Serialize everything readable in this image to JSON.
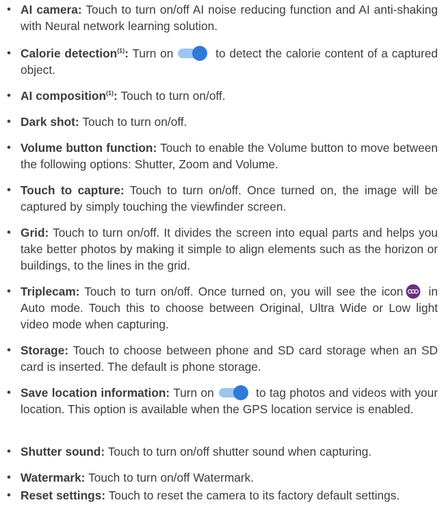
{
  "bullet_char": "•",
  "items": [
    {
      "term": "AI camera:",
      "text": "Touch to turn on/off AI noise reducing function and AI anti-shaking with Neural network learning solution."
    },
    {
      "term": "Calorie detection",
      "note": "(1)",
      "term_suffix": ":",
      "text_before": "Turn on",
      "text_after": "to detect the calorie content of a captured object."
    },
    {
      "term": "AI composition",
      "note": "(1)",
      "term_suffix": ":",
      "text": "Touch to turn on/off."
    },
    {
      "term": "Dark shot:",
      "text": "Touch to turn on/off."
    },
    {
      "term": "Volume button function:",
      "text": "Touch to enable the Volume button to move between the following options: Shutter, Zoom and Volume."
    },
    {
      "term": "Touch to capture:",
      "text": "Touch to turn on/off. Once turned on, the image will be captured by simply touching the viewfinder screen."
    },
    {
      "term": "Grid:",
      "text": "Touch to turn on/off. It divides the screen into equal parts and helps you take better photos by making it simple to align elements such as the horizon or buildings, to the lines in the grid."
    },
    {
      "term": "Triplecam:",
      "text_before": "Touch to turn on/off. Once turned on, you will see the icon",
      "text_after": "in Auto mode. Touch this to choose between Original, Ultra Wide or Low light video mode when capturing."
    },
    {
      "term": "Storage:",
      "text": "Touch to choose between phone and SD card storage when an SD card is inserted. The default is phone storage."
    },
    {
      "term": "Save location information:",
      "text_before": "Turn on",
      "text_after": "to tag photos and videos with your location. This option is available when the GPS location service is enabled."
    },
    {
      "term": "Shutter sound:",
      "text": "Touch to turn on/off shutter sound when capturing."
    },
    {
      "term": "Watermark:",
      "text": "Touch to turn on/off Watermark."
    },
    {
      "term": "Reset settings:",
      "text": "Touch to reset the camera to its factory default settings."
    }
  ],
  "icons": {
    "toggle_on": "toggle-switch-on-icon",
    "triplecam": "triplecam-icon"
  },
  "colors": {
    "text": "#3d3d3d",
    "toggle_track": "#9cc6ef",
    "toggle_knob": "#2f7bd8",
    "triplecam_icon": "#6a2f7f"
  }
}
